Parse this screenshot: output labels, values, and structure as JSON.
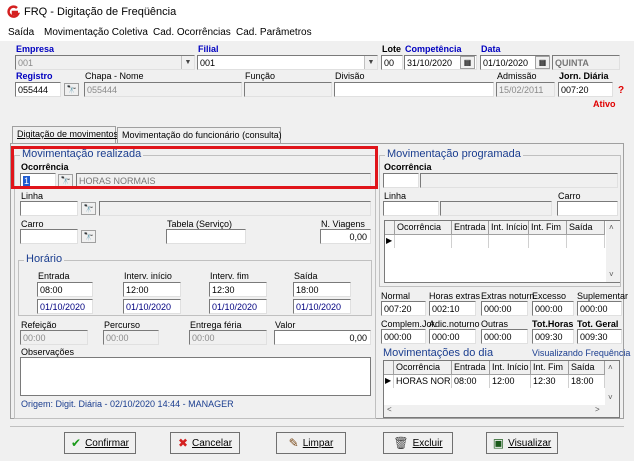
{
  "window": {
    "title": "FRQ - Digitação de Freqüência"
  },
  "menu": [
    "Saída",
    "Movimentação Coletiva",
    "Cad. Ocorrências",
    "Cad. Parâmetros"
  ],
  "header": {
    "empresa_label": "Empresa",
    "empresa_value": "001",
    "filial_label": "Filial",
    "filial_value": "001",
    "lote_label": "Lote",
    "lote_value": "00",
    "competencia_label": "Competência",
    "competencia_value": "31/10/2020",
    "data_label": "Data",
    "data_value": "01/10/2020",
    "weekday": "QUINTA",
    "registro_label": "Registro",
    "registro_value": "055444",
    "chapa_nome_label": "Chapa  -  Nome",
    "chapa_value": "055444",
    "funcao_label": "Função",
    "divisao_label": "Divisão",
    "admissao_label": "Admissão",
    "admissao_value": "15/02/2011",
    "jornada_label": "Jorn. Diária",
    "jornada_value": "007:20",
    "status": "Ativo",
    "help": "?"
  },
  "tabs": [
    "Digitação de movimentos",
    "Movimentação do funcionário (consulta)"
  ],
  "realizada": {
    "title": "Movimentação realizada",
    "ocorrencia_label": "Ocorrência",
    "ocorrencia_code": "1",
    "ocorrencia_desc": "HORAS NORMAIS",
    "linha_label": "Linha",
    "carro_label": "Carro",
    "tabela_label": "Tabela (Serviço)",
    "viagens_label": "N. Viagens",
    "viagens_value": "0,00",
    "horario_title": "Horário",
    "entrada_label": "Entrada",
    "entrada_value": "08:00",
    "entrada_date": "01/10/2020",
    "int_inicio_label": "Interv. início",
    "int_inicio_value": "12:00",
    "int_inicio_date": "01/10/2020",
    "int_fim_label": "Interv. fim",
    "int_fim_value": "12:30",
    "int_fim_date": "01/10/2020",
    "saida_label": "Saída",
    "saida_value": "18:00",
    "saida_date": "01/10/2020",
    "refeicao_label": "Refeição",
    "refeicao_value": "00:00",
    "percurso_label": "Percurso",
    "percurso_value": "00:00",
    "entrega_label": "Entrega féria",
    "entrega_value": "00:00",
    "valor_label": "Valor",
    "valor_value": "0,00",
    "observacoes_label": "Observações",
    "origem": "Origem: Digit. Diária - 02/10/2020 14:44 - MANAGER"
  },
  "programada": {
    "title": "Movimentação programada",
    "ocorrencia_label": "Ocorrência",
    "linha_label": "Linha",
    "carro_label": "Carro",
    "grid_headers": [
      "Ocorrência",
      "Entrada",
      "Int. Início",
      "Int. Fim",
      "Saída"
    ]
  },
  "totals": {
    "labels_row1": [
      "Normal",
      "Horas extras",
      "Extras noturn.",
      "Excesso",
      "Suplementar"
    ],
    "values_row1": [
      "007:20",
      "002:10",
      "000:00",
      "000:00",
      "000:00"
    ],
    "labels_row2": [
      "Complem.Jor.",
      "Adic.noturno",
      "Outras",
      "Tot.Horas",
      "Tot. Geral"
    ],
    "values_row2": [
      "000:00",
      "000:00",
      "000:00",
      "009:30",
      "009:30"
    ]
  },
  "dia": {
    "title": "Movimentações do dia",
    "link": "Visualizando Frequência",
    "grid_headers": [
      "Ocorrência",
      "Entrada",
      "Int. Início",
      "Int. Fim",
      "Saída"
    ],
    "rows": [
      [
        "HORAS NORM",
        "08:00",
        "12:00",
        "12:30",
        "18:00"
      ]
    ]
  },
  "buttons": {
    "confirmar": "Confirmar",
    "cancelar": "Cancelar",
    "limpar": "Limpar",
    "excluir": "Excluir",
    "visualizar": "Visualizar"
  }
}
